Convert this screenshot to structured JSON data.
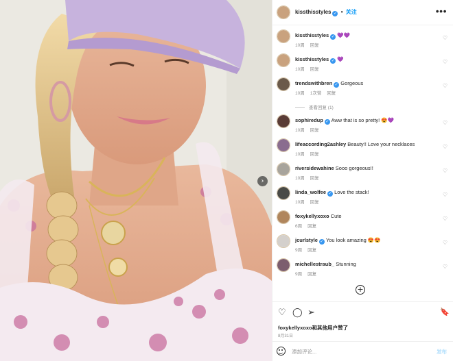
{
  "post": {
    "author": "kissthisstyles",
    "follow_label": "关注",
    "separator": "•",
    "more_icon": "more-horizontal-icon",
    "verified_mark": "✓"
  },
  "carousel": {
    "next_icon": "chevron-right-icon",
    "glyph": "›"
  },
  "comments": [
    {
      "user": "kissthisstyles",
      "verified": true,
      "text": "💜💜",
      "time": "10周",
      "likes": "",
      "reply": "回复",
      "avatar_color": "#c9a27e"
    },
    {
      "user": "kissthisstyles",
      "verified": true,
      "text": "💜",
      "time": "10周",
      "likes": "",
      "reply": "回复",
      "avatar_color": "#c9a27e"
    },
    {
      "user": "trendswithbren",
      "verified": true,
      "text": "Gorgeous",
      "time": "10周",
      "likes": "1次赞",
      "reply": "回复",
      "avatar_color": "#6b5a4a"
    },
    {
      "user": "sophiredup",
      "verified": true,
      "text": "Aww that is so pretty! 😍💜",
      "time": "10周",
      "likes": "",
      "reply": "回复",
      "avatar_color": "#5a3c36"
    },
    {
      "user": "lifeaccording2ashley",
      "verified": false,
      "text": "Beauty!! Love your necklaces",
      "time": "10周",
      "likes": "",
      "reply": "回复",
      "avatar_color": "#8a6d8f"
    },
    {
      "user": "riversidewahine",
      "verified": false,
      "text": "Sooo gorgeous!!",
      "time": "10周",
      "likes": "",
      "reply": "回复",
      "avatar_color": "#a8a49c"
    },
    {
      "user": "linda_wolfee",
      "verified": true,
      "text": "Love the stack!",
      "time": "10周",
      "likes": "",
      "reply": "回复",
      "avatar_color": "#4a4a46"
    },
    {
      "user": "foxykellyxoxo",
      "verified": false,
      "text": "Cute",
      "time": "6周",
      "likes": "",
      "reply": "回复",
      "avatar_color": "#b0865c"
    },
    {
      "user": "jcurlstyle",
      "verified": true,
      "text": "You look amazing 😍😍",
      "time": "9周",
      "likes": "",
      "reply": "回复",
      "avatar_color": "#d4d0cc"
    },
    {
      "user": "michellestraub_",
      "verified": false,
      "text": "Stunning",
      "time": "9周",
      "likes": "",
      "reply": "回复",
      "avatar_color": "#7c5d6e"
    }
  ],
  "view_replies": "查看回复 (1)",
  "heart_glyph": "♡",
  "load_more_glyph": "+",
  "actions": {
    "like_glyph": "♡",
    "comment_glyph": "◯",
    "share_glyph": "➢",
    "save_glyph": "🔖"
  },
  "likes_text": "foxykellyxoxo和其他用户赞了",
  "post_date": "8月31日",
  "comment_box": {
    "placeholder": "添加评论...",
    "post_label": "发布"
  },
  "colors": {
    "accent": "#0095f6",
    "verified": "#3897f0",
    "muted": "#8e8e8e"
  }
}
